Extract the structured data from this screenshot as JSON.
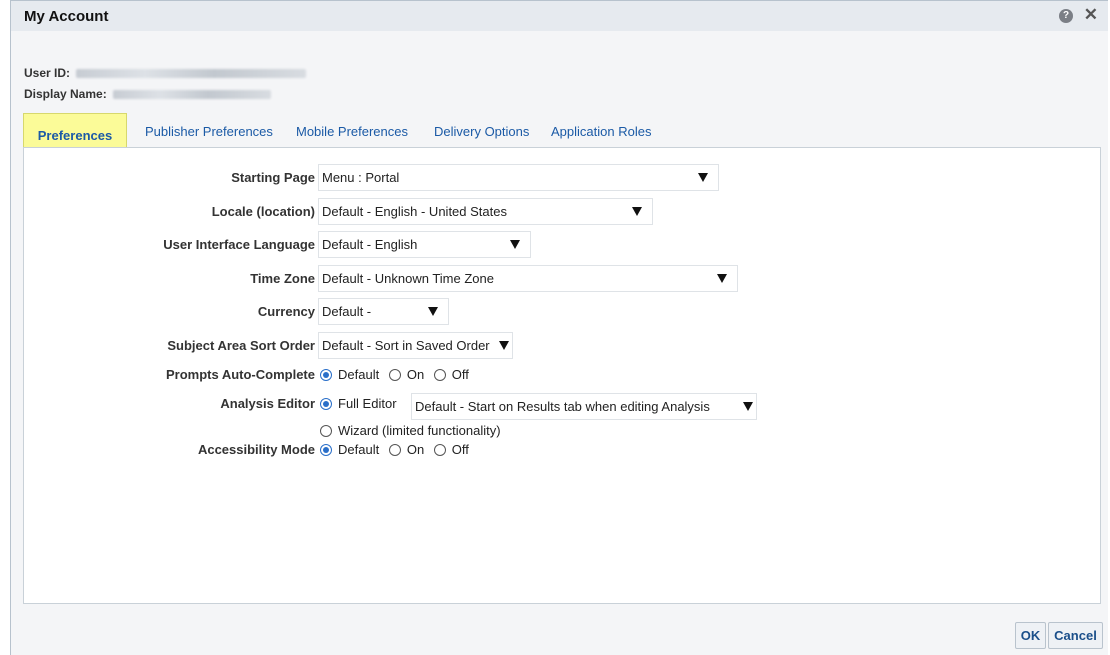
{
  "dialog": {
    "title": "My Account",
    "help_icon": "question-circle-icon",
    "close_label": "✕"
  },
  "account": {
    "user_id_label": "User ID:",
    "display_name_label": "Display Name:"
  },
  "tabs": [
    {
      "label": "Preferences",
      "active": true
    },
    {
      "label": "Publisher Preferences"
    },
    {
      "label": "Mobile Preferences"
    },
    {
      "label": "Delivery Options"
    },
    {
      "label": "Application Roles"
    }
  ],
  "preferences": {
    "starting_page": {
      "label": "Starting Page",
      "value": "Menu : Portal"
    },
    "locale": {
      "label": "Locale (location)",
      "value": "Default - English - United States"
    },
    "ui_language": {
      "label": "User Interface Language",
      "value": "Default - English"
    },
    "time_zone": {
      "label": "Time Zone",
      "value": "Default - Unknown Time Zone"
    },
    "currency": {
      "label": "Currency",
      "value": "Default -"
    },
    "sort_order": {
      "label": "Subject Area Sort Order",
      "value": "Default - Sort in Saved Order"
    },
    "prompts_autocomplete": {
      "label": "Prompts Auto-Complete",
      "options": [
        "Default",
        "On",
        "Off"
      ],
      "selected": "Default"
    },
    "analysis_editor": {
      "label": "Analysis Editor",
      "full_editor": "Full Editor",
      "full_editor_value": "Default - Start on Results tab when editing Analysis",
      "wizard": "Wizard (limited functionality)",
      "selected": "Full Editor"
    },
    "accessibility_mode": {
      "label": "Accessibility Mode",
      "options": [
        "Default",
        "On",
        "Off"
      ],
      "selected": "Default"
    }
  },
  "buttons": {
    "ok": "OK",
    "cancel": "Cancel"
  },
  "colors": {
    "tab_highlight": "#fbfb98",
    "link": "#1b5aa6",
    "radio_selected": "#2a6fc9"
  }
}
